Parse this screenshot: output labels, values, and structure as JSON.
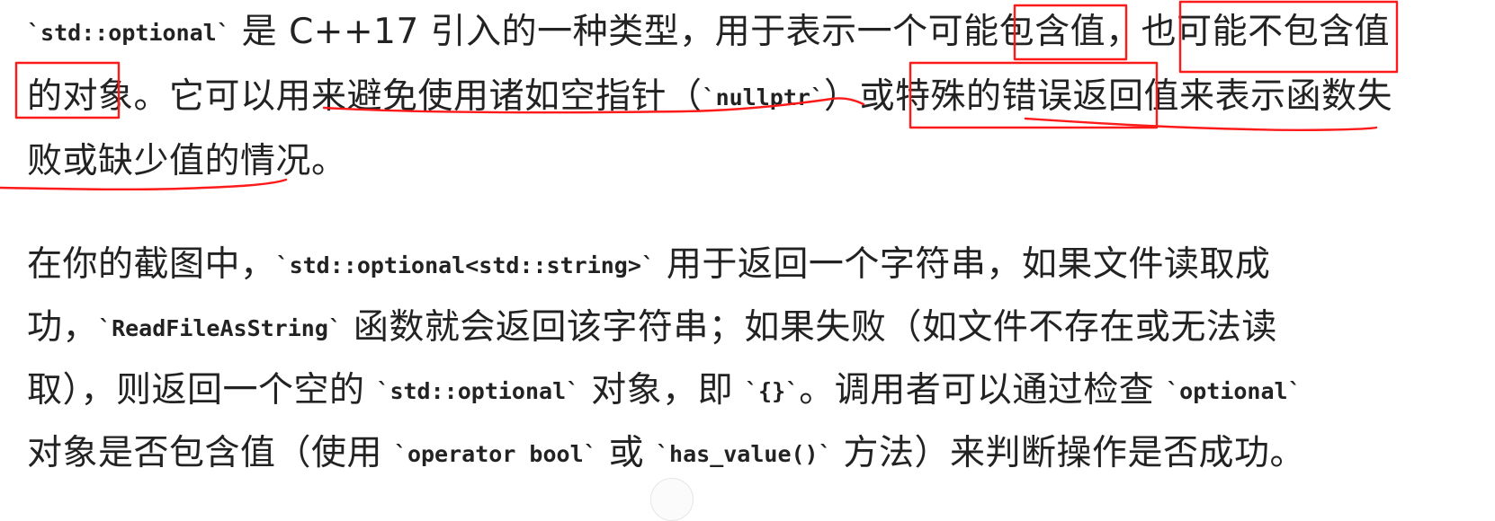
{
  "paragraph1": {
    "lines": [
      [
        "`std::optional`",
        " 是 C++17 引入的一种类型，用于表示一个可能包含值，也可能不包含值"
      ],
      [
        "的对象。它可以用来避免使用诸如空指针（",
        "`nullptr`",
        "）或特殊的错误返回值来表示函数失"
      ],
      [
        "败或缺少值的情况。"
      ]
    ]
  },
  "paragraph2": {
    "lines": [
      [
        "在你的截图中，",
        "`std::optional<std::string>`",
        " 用于返回一个字符串，如果文件读取成"
      ],
      [
        "功，",
        "`ReadFileAsString`",
        " 函数就会返回该字符串；如果失败（如文件不存在或无法读"
      ],
      [
        "取），则返回一个空的 ",
        "`std::optional`",
        " 对象，即 ",
        "`{}`",
        "。调用者可以通过检查 ",
        "`optional`"
      ],
      [
        "对象是否包含值（使用 ",
        "`operator bool`",
        " 或 ",
        "`has_value()`",
        " 方法）来判断操作是否成功。"
      ]
    ]
  },
  "annotation_color": "#ff1a1a"
}
